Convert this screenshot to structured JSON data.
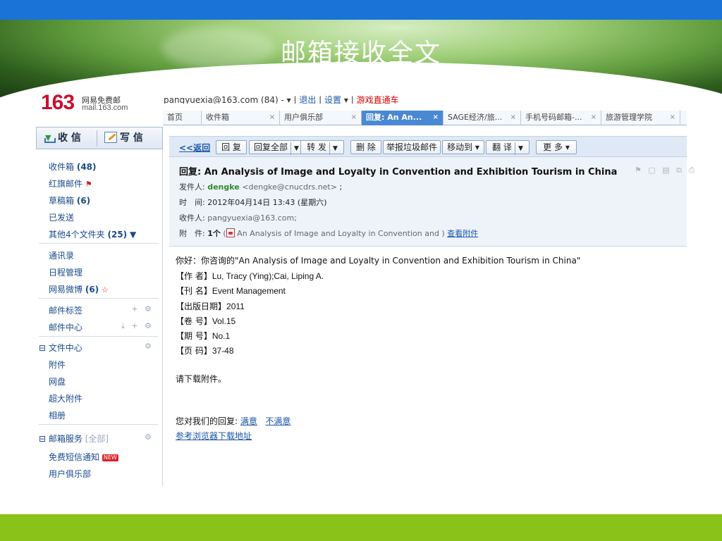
{
  "slide": {
    "title": "邮箱接收全文"
  },
  "header": {
    "logo_number": "163",
    "logo_cn": "网易免费邮",
    "logo_domain": "mail.163.com",
    "account": "pangyuexia@163.com (84)",
    "links": [
      "退出",
      "设置",
      "游戏直通车"
    ]
  },
  "tabs": [
    {
      "label": "首页"
    },
    {
      "label": "收件箱"
    },
    {
      "label": "用户俱乐部"
    },
    {
      "label": "回复: An An..."
    },
    {
      "label": "SAGE经济/旅..."
    },
    {
      "label": "手机号码邮箱-..."
    },
    {
      "label": "旅游管理学院"
    }
  ],
  "sidebar": {
    "receive": "收 信",
    "write": "写 信",
    "inbox": "收件箱",
    "inbox_count": "(48)",
    "flagged": "红旗邮件",
    "drafts": "草稿箱",
    "drafts_count": "(6)",
    "sent": "已发送",
    "other": "其他4个文件夹",
    "other_count": "(25)",
    "contacts": "通讯录",
    "calendar": "日程管理",
    "weibo": "网易微博",
    "weibo_count": "(6)",
    "tags": "邮件标签",
    "center": "邮件中心",
    "files": "文件中心",
    "attachments": "附件",
    "netdisk": "网盘",
    "big_attach": "超大附件",
    "album": "相册",
    "services": "邮箱服务",
    "services_all": "[全部]",
    "sms": "免费短信通知",
    "new_badge": "NEW",
    "club": "用户俱乐部"
  },
  "toolbar": {
    "back": "<<返回",
    "reply": "回 复",
    "reply_all": "回复全部",
    "forward": "转 发",
    "delete": "删 除",
    "report": "举报垃圾邮件",
    "move": "移动到",
    "translate": "翻 译",
    "more": "更 多"
  },
  "message": {
    "subject": "回复: An Analysis of Image and Loyalty in Convention and Exhibition Tourism in China",
    "from_label": "发件人:",
    "from_name": "dengke",
    "from_addr": "<dengke@cnucdrs.net>",
    "time_label": "时　间:",
    "time": "2012年04月14日 13:43 (星期六)",
    "to_label": "收件人:",
    "to": "pangyuexia@163.com;",
    "attach_label": "附　件:",
    "attach_count": "1个",
    "attach_name": "An Analysis of Image and Loyalty in Convention and )",
    "view_attach": "查看附件"
  },
  "body": {
    "greeting": "你好：你咨询的\"An Analysis of Image and Loyalty in Convention and Exhibition Tourism in China\"",
    "author_label": "【作 者】",
    "author": "Lu, Tracy (Ying);Cai, Liping A.",
    "journal_label": "【刊 名】",
    "journal": "Event Management",
    "date_label": "【出版日期】",
    "date": "2011",
    "volume_label": "【卷 号】",
    "volume": "Vol.15",
    "issue_label": "【期 号】",
    "issue": "No.1",
    "pages_label": "【页 码】",
    "pages": "37-48",
    "download_note": "请下载附件。",
    "feedback_label": "您对我们的回复:",
    "satisfied": "满意",
    "unsatisfied": "不满意",
    "browser_link": "参考浏览器下载地址"
  }
}
